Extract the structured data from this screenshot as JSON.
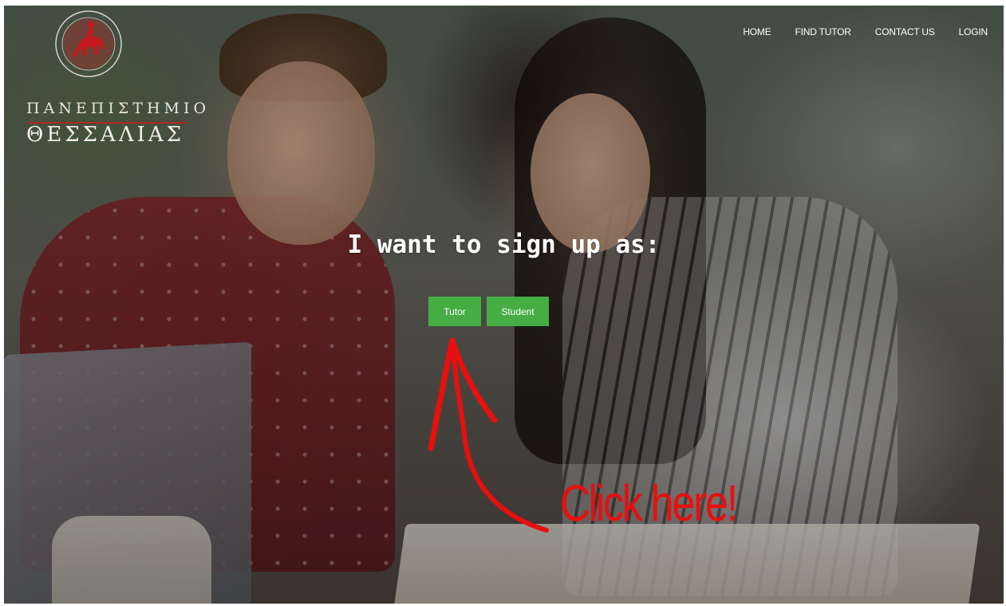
{
  "logo": {
    "line1": "ΠΑΝΕΠΙΣΤΗΜΙΟ",
    "line2": "ΘΕΣΣΑΛΙΑΣ",
    "seal_icon": "university-seal-icon",
    "brand_color": "#b3262a"
  },
  "nav": {
    "items": [
      {
        "label": "HOME"
      },
      {
        "label": "FIND TUTOR"
      },
      {
        "label": "CONTACT US"
      },
      {
        "label": "LOGIN"
      }
    ]
  },
  "main": {
    "headline": "I want to sign up as:",
    "buttons": {
      "tutor": "Tutor",
      "student": "Student"
    },
    "button_color": "#46ad45"
  },
  "annotation": {
    "text": "Click here!",
    "color": "#e80f0f",
    "arrow_icon": "curved-arrow-icon"
  }
}
